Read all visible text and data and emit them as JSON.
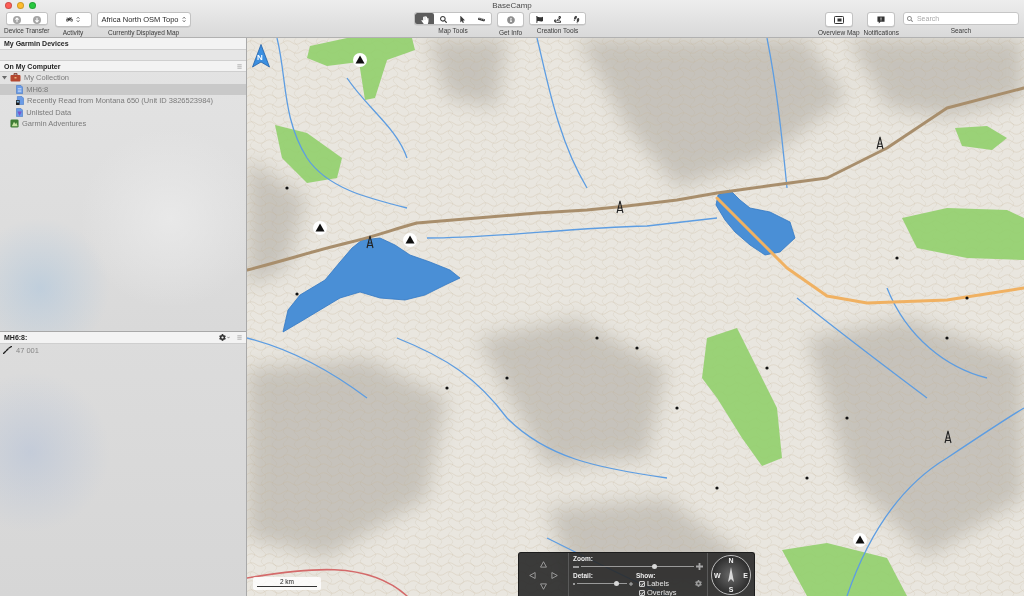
{
  "window": {
    "title": "BaseCamp"
  },
  "toolbar": {
    "device_transfer": {
      "label": "Device Transfer"
    },
    "activity": {
      "label": "Activity"
    },
    "map_selector": {
      "value": "Africa North OSM Topo",
      "label": "Currently Displayed Map"
    },
    "map_tools": {
      "label": "Map Tools",
      "tools": [
        {
          "kind": "pan",
          "selected": true
        },
        {
          "kind": "zoom",
          "selected": false
        },
        {
          "kind": "select",
          "selected": false
        },
        {
          "kind": "measure",
          "selected": false
        }
      ]
    },
    "get_info": {
      "label": "Get Info"
    },
    "creation_tools": {
      "label": "Creation Tools"
    },
    "overview_map": {
      "label": "Overview Map"
    },
    "notifications": {
      "label": "Notifications"
    },
    "search": {
      "placeholder": "Search",
      "label": "Search"
    }
  },
  "sidebar": {
    "devices_title": "My Garmin Devices",
    "computer_title": "On My Computer",
    "tree": [
      {
        "kind": "collection",
        "label": "My Collection",
        "expanded": true,
        "selected": false,
        "children": [
          {
            "kind": "list",
            "label": "MH6:8",
            "selected": true
          },
          {
            "kind": "device_list",
            "label": "Recently Read from Montana 650 (Unit ID 3826523984)",
            "selected": false
          },
          {
            "kind": "unlisted",
            "label": "Unlisted Data",
            "selected": false
          }
        ]
      },
      {
        "kind": "adventures",
        "label": "Garmin Adventures",
        "selected": false
      }
    ]
  },
  "list_panel": {
    "title": "MH6:8:",
    "items": [
      {
        "kind": "track",
        "label": "47 001",
        "selected": false
      }
    ]
  },
  "map": {
    "north_label": "N",
    "scale": "2 km"
  },
  "map_controls": {
    "zoom": {
      "label": "Zoom:",
      "level": 0.66
    },
    "detail": {
      "label": "Detail:",
      "level": 0.82
    },
    "show": {
      "label": "Show:",
      "options": [
        {
          "label": "Labels",
          "checked": true
        },
        {
          "label": "Overlays",
          "checked": true
        }
      ]
    },
    "compass": {
      "north": "N",
      "east": "E",
      "south": "S",
      "west": "W"
    }
  }
}
